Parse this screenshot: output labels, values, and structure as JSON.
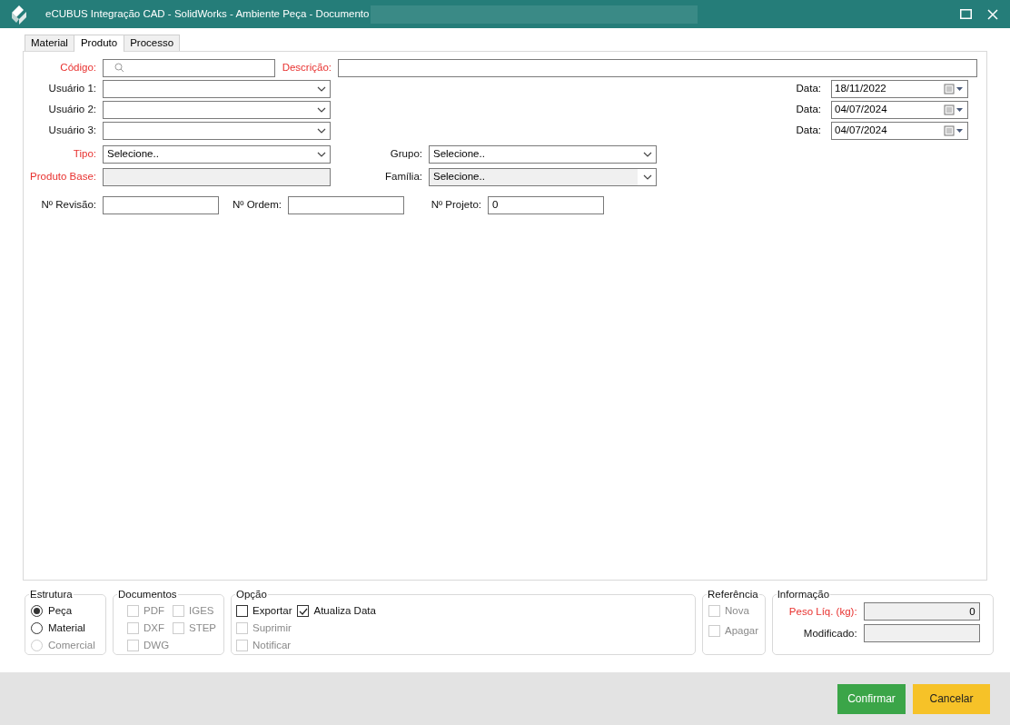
{
  "window": {
    "title": "eCUBUS Integração CAD - SolidWorks - Ambiente Peça - Documento"
  },
  "tabs": [
    {
      "label": "Material",
      "selected": false
    },
    {
      "label": "Produto",
      "selected": true
    },
    {
      "label": "Processo",
      "selected": false
    }
  ],
  "codigo": {
    "label": "Código:",
    "required": true
  },
  "descricao": {
    "label": "Descrição:",
    "required": true
  },
  "usuarios": [
    {
      "label": "Usuário 1:",
      "date_label": "Data:",
      "date": "18/11/2022"
    },
    {
      "label": "Usuário 2:",
      "date_label": "Data:",
      "date": "04/07/2024"
    },
    {
      "label": "Usuário 3:",
      "date_label": "Data:",
      "date": "04/07/2024"
    }
  ],
  "tipo": {
    "label": "Tipo:",
    "required": true,
    "value": "Selecione.."
  },
  "grupo": {
    "label": "Grupo:",
    "required": false,
    "value": "Selecione.."
  },
  "produto_base": {
    "label": "Produto Base:",
    "required": true,
    "disabled": true
  },
  "familia": {
    "label": "Família:",
    "required": false,
    "value": "Selecione..",
    "disabled": true
  },
  "revisao": {
    "label": "Nº Revisão:"
  },
  "ordem": {
    "label": "Nº Ordem:"
  },
  "projeto": {
    "label": "Nº Projeto:",
    "value": "0"
  },
  "estrutura": {
    "title": "Estrutura",
    "options": [
      {
        "label": "Peça",
        "selected": true,
        "disabled": false
      },
      {
        "label": "Material",
        "selected": false,
        "disabled": false
      },
      {
        "label": "Comercial",
        "selected": false,
        "disabled": true
      }
    ]
  },
  "documentos": {
    "title": "Documentos",
    "items": [
      {
        "label": "PDF",
        "checked": false,
        "disabled": true
      },
      {
        "label": "IGES",
        "checked": false,
        "disabled": true
      },
      {
        "label": "DXF",
        "checked": false,
        "disabled": true
      },
      {
        "label": "STEP",
        "checked": false,
        "disabled": true
      },
      {
        "label": "DWG",
        "checked": false,
        "disabled": true
      }
    ]
  },
  "opcao": {
    "title": "Opção",
    "items": [
      {
        "label": "Exportar",
        "checked": false,
        "disabled": false
      },
      {
        "label": "Atualiza Data",
        "checked": true,
        "disabled": false
      },
      {
        "label": "Suprimir",
        "checked": false,
        "disabled": true
      },
      {
        "label": "Notificar",
        "checked": false,
        "disabled": true
      }
    ]
  },
  "referencia": {
    "title": "Referência",
    "items": [
      {
        "label": "Nova",
        "checked": false,
        "disabled": true
      },
      {
        "label": "Apagar",
        "checked": false,
        "disabled": true
      }
    ]
  },
  "informacao": {
    "title": "Informação",
    "fields": [
      {
        "label": "Peso Líq. (kg):",
        "required": true,
        "value": "0"
      },
      {
        "label": "Modificado:",
        "required": false
      }
    ]
  },
  "buttons": [
    {
      "label": "Confirmar",
      "kind": "confirm"
    },
    {
      "label": "Cancelar",
      "kind": "cancel"
    }
  ]
}
